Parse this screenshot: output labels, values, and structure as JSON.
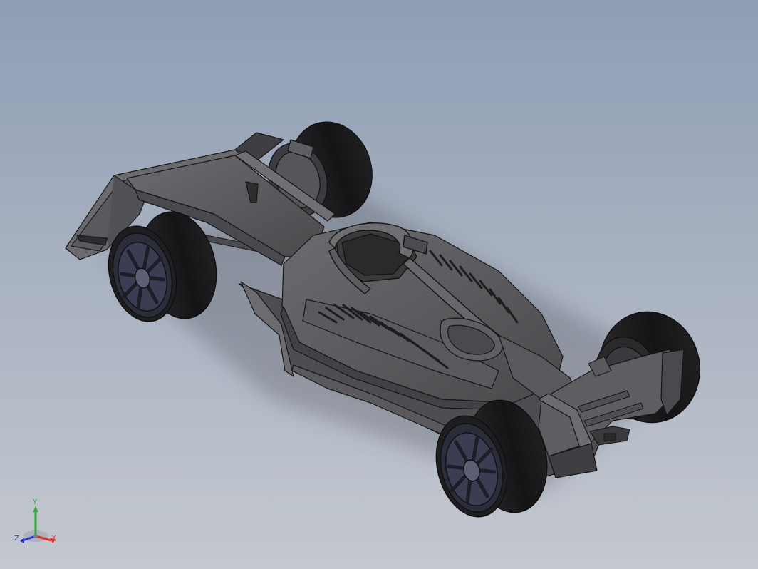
{
  "viewport": {
    "background_top": "#8f9db4",
    "background_bottom": "#c4c8cf",
    "model": "race-car-assembly",
    "display_style": "shaded-with-edges",
    "body_color": "#5d5d60",
    "tire_color": "#1c1c1e",
    "rim_color": "#3b3d52"
  },
  "triad": {
    "x_label": "X",
    "y_label": "Y",
    "z_label": "Z",
    "x_color": "#e0322a",
    "y_color": "#2ea83a",
    "z_color": "#2a3ad8"
  }
}
